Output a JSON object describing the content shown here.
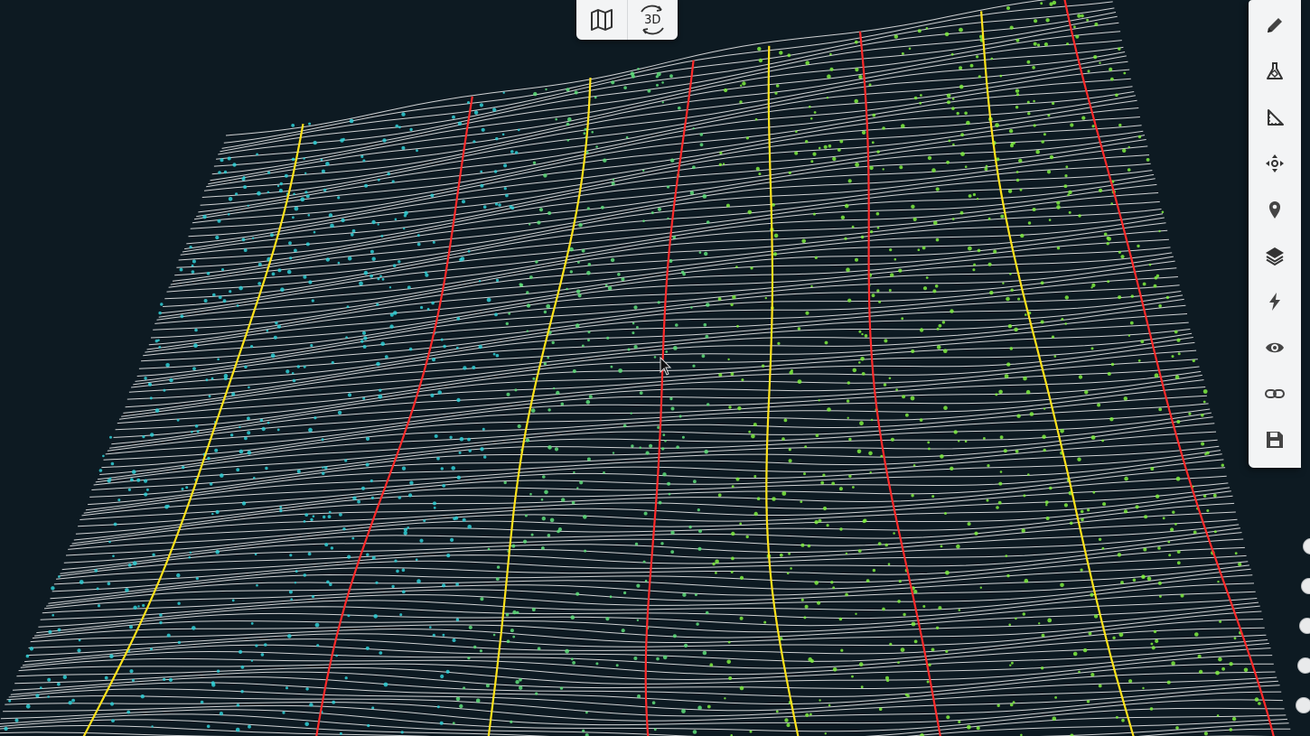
{
  "view_toggle": {
    "map_icon": "map-icon",
    "label_3d": "3D",
    "rotate_icon": "rotate-3d-icon",
    "active": "3D"
  },
  "toolbar": {
    "items": [
      {
        "name": "pencil-icon",
        "tooltip": ""
      },
      {
        "name": "flask-icon",
        "tooltip": ""
      },
      {
        "name": "ruler-triangle-icon",
        "tooltip": ""
      },
      {
        "name": "move-arrows-icon",
        "tooltip": ""
      },
      {
        "name": "map-pin-icon",
        "tooltip": ""
      },
      {
        "name": "layers-icon",
        "tooltip": ""
      },
      {
        "name": "lightning-icon",
        "tooltip": ""
      },
      {
        "name": "eye-icon",
        "tooltip": ""
      },
      {
        "name": "link-icon",
        "tooltip": ""
      },
      {
        "name": "save-icon",
        "tooltip": ""
      }
    ]
  },
  "scene": {
    "background": "#0d1a22",
    "contour_minor_color": "#f2f2f2",
    "contour_major_red": "#ff2a2a",
    "contour_major_yellow": "#ffe21a",
    "points_low_color": "#2fd0d6",
    "points_mid_color": "#5fe07a",
    "points_high_color": "#7ff040"
  }
}
